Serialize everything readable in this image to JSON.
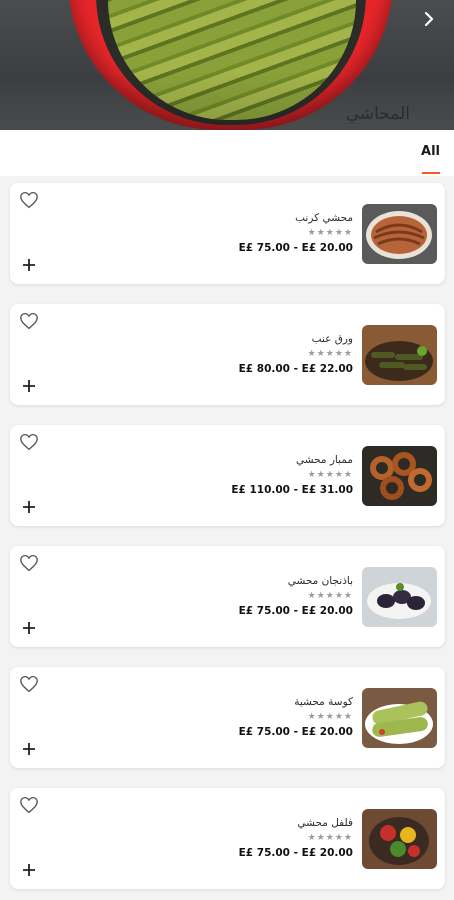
{
  "header": {
    "title": "المحاشي",
    "back_icon": "chevron-right-icon"
  },
  "tabs": [
    {
      "label": "All",
      "active": true
    }
  ],
  "accent_color": "#f05a28",
  "items": [
    {
      "name": "محشي كرنب",
      "stars": "★★★★★",
      "price": "E£ 75.00 - E£ 20.00",
      "thumb": "stuffed-cabbage"
    },
    {
      "name": "ورق عنب",
      "stars": "★★★★★",
      "price": "E£ 80.00 - E£ 22.00",
      "thumb": "grape-leaves"
    },
    {
      "name": "ممبار محشي",
      "stars": "★★★★★",
      "price": "E£ 110.00 - E£ 31.00",
      "thumb": "mombar"
    },
    {
      "name": "باذنجان محشي",
      "stars": "★★★★★",
      "price": "E£ 75.00 - E£ 20.00",
      "thumb": "stuffed-eggplant"
    },
    {
      "name": "كوسة محشية",
      "stars": "★★★★★",
      "price": "E£ 75.00 - E£ 20.00",
      "thumb": "stuffed-zucchini"
    },
    {
      "name": "فلفل محشي",
      "stars": "★★★★★",
      "price": "E£ 75.00 - E£ 20.00",
      "thumb": "stuffed-peppers"
    }
  ]
}
